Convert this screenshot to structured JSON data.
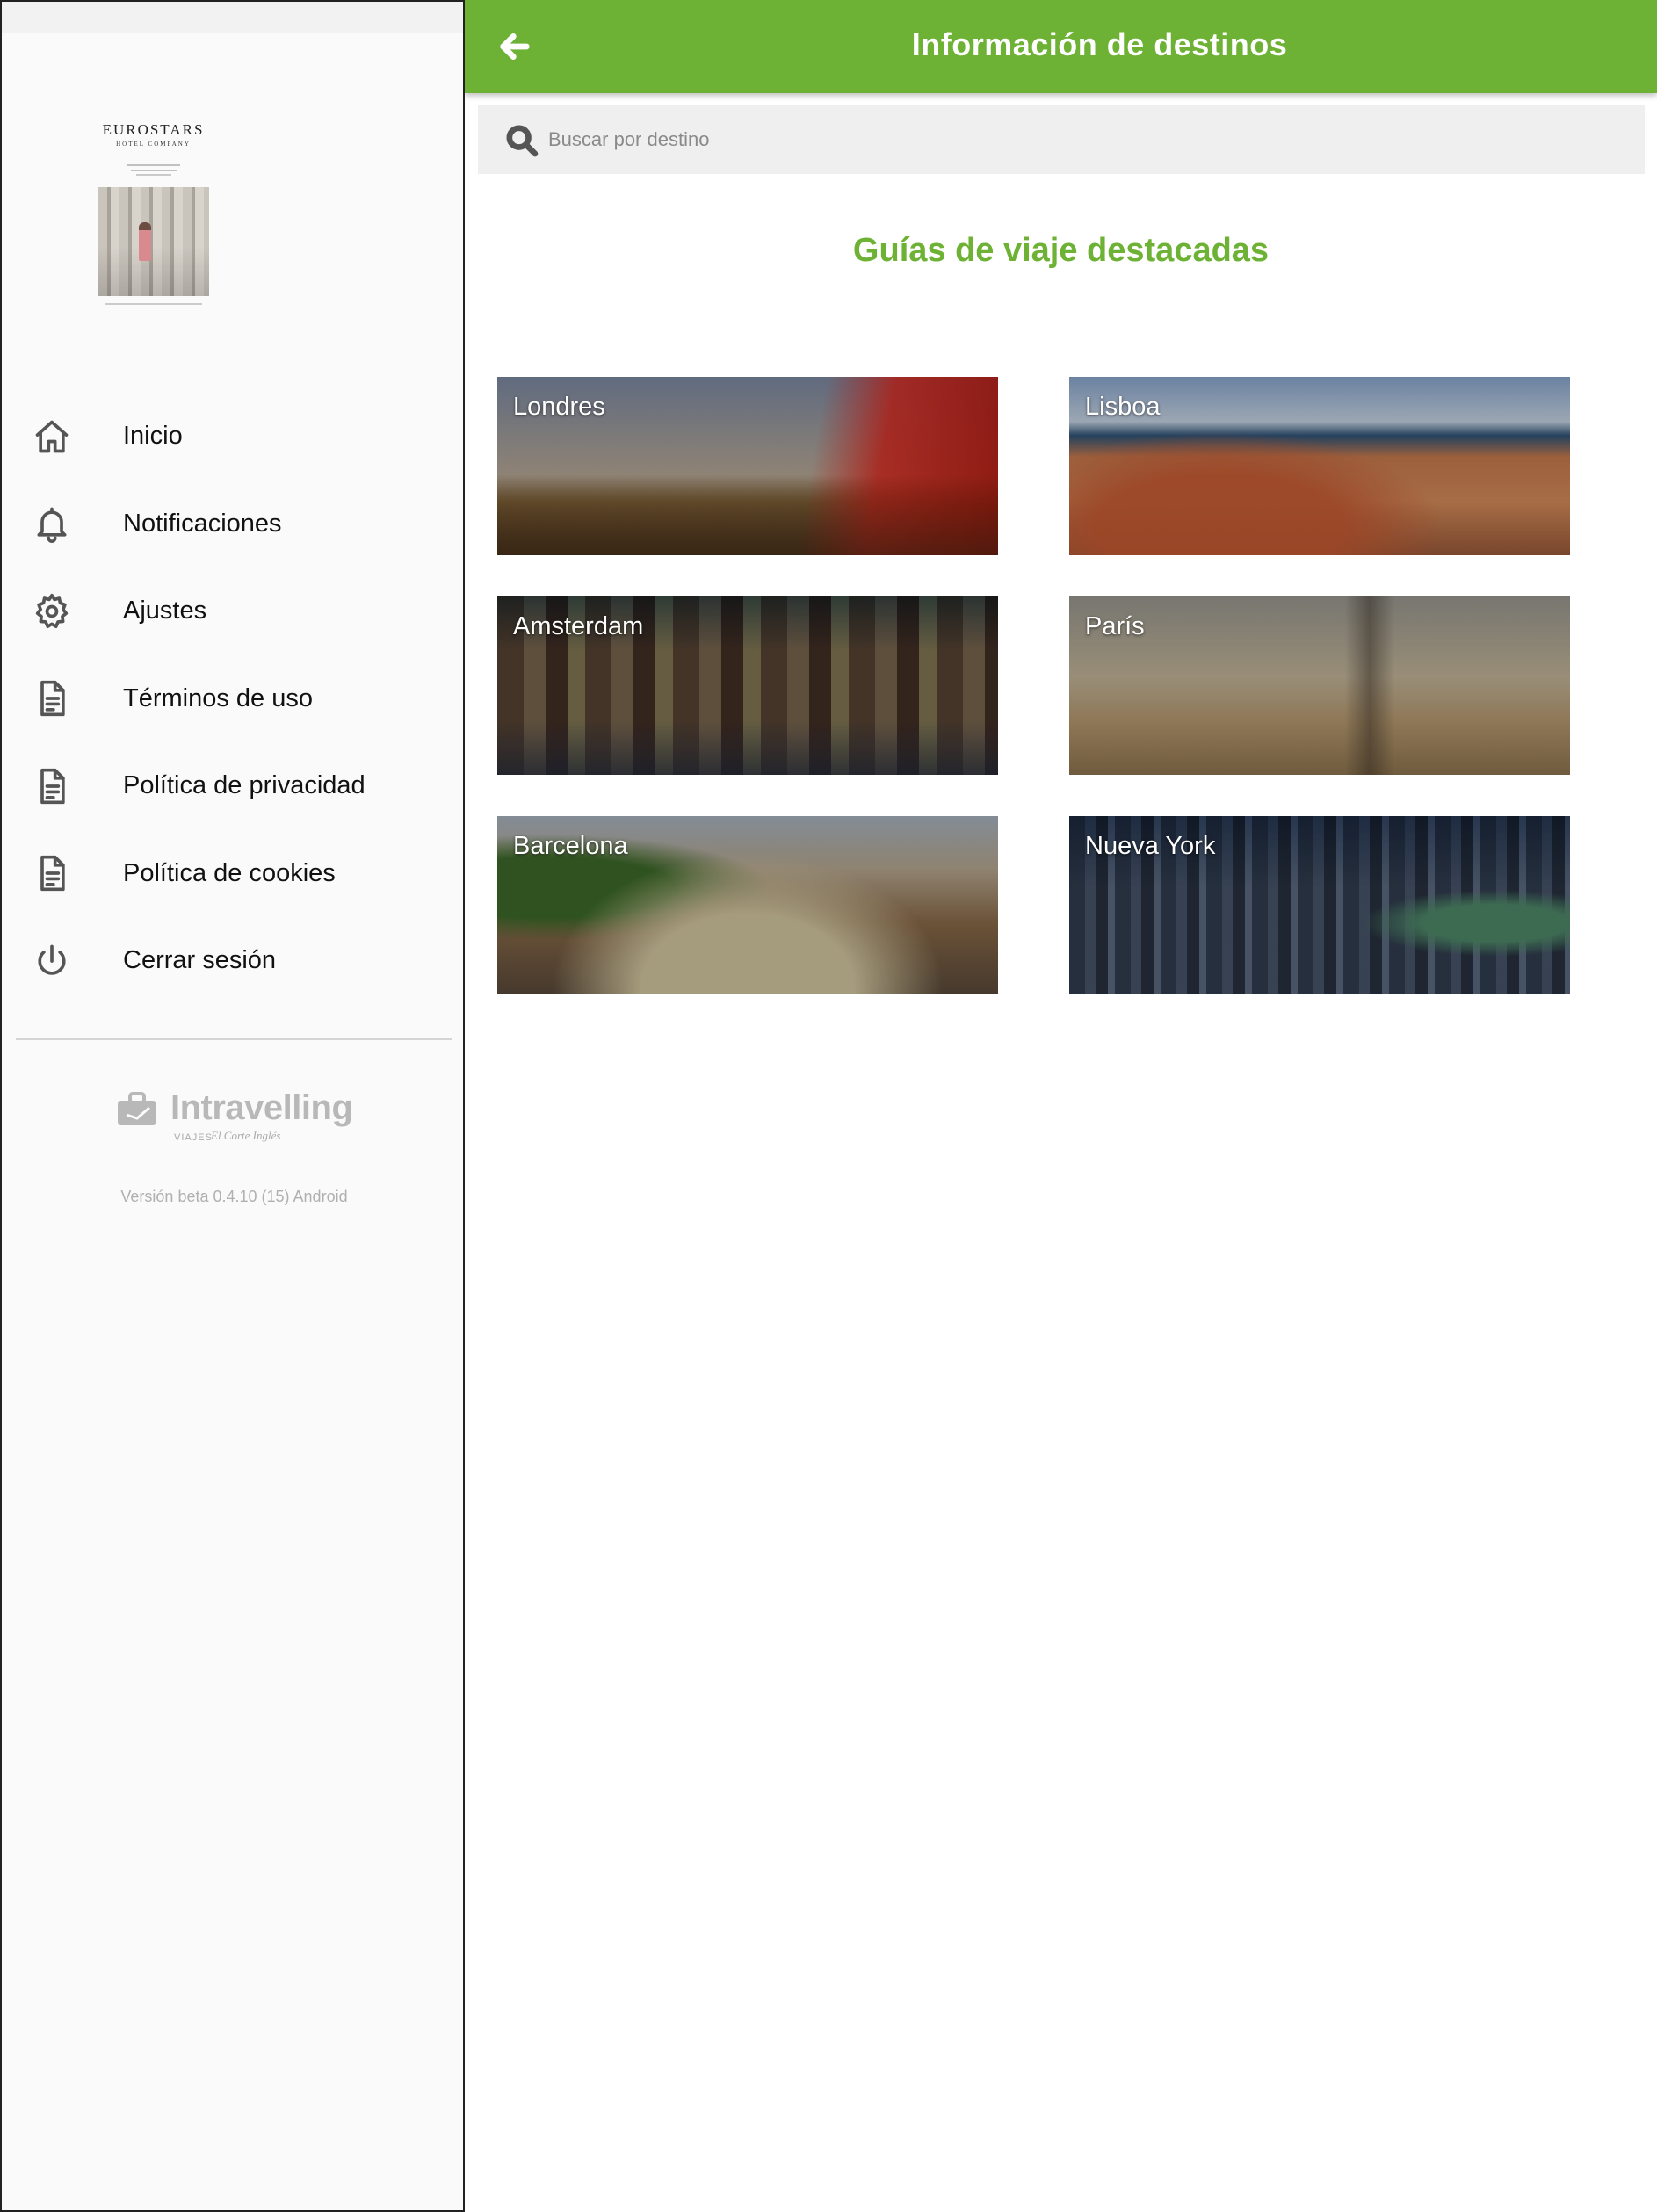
{
  "drawer": {
    "brand": {
      "name": "EUROSTARS",
      "subtitle": "HOTEL COMPANY"
    },
    "menu": [
      {
        "label": "Inicio",
        "icon": "home-icon"
      },
      {
        "label": "Notificaciones",
        "icon": "bell-icon"
      },
      {
        "label": "Ajustes",
        "icon": "gear-icon"
      },
      {
        "label": "Términos de uso",
        "icon": "document-icon"
      },
      {
        "label": "Política de privacidad",
        "icon": "document-icon"
      },
      {
        "label": "Política de cookies",
        "icon": "document-icon"
      },
      {
        "label": "Cerrar sesión",
        "icon": "power-icon"
      }
    ],
    "footer": {
      "logo_text": "Intravelling",
      "logo_sub": "VIAJES",
      "logo_sub_brand": "El Corte Inglés",
      "version": "Versión beta 0.4.10 (15) Android"
    }
  },
  "appbar": {
    "title": "Información de destinos",
    "back_icon": "arrow-left-icon",
    "color": "#6db234"
  },
  "search": {
    "placeholder": "Buscar por destino",
    "value": "",
    "icon": "search-icon"
  },
  "section": {
    "title": "Guías de viaje destacadas",
    "color": "#6db234"
  },
  "destinations": [
    {
      "label": "Londres"
    },
    {
      "label": "Lisboa"
    },
    {
      "label": "Amsterdam"
    },
    {
      "label": "París"
    },
    {
      "label": "Barcelona"
    },
    {
      "label": "Nueva York"
    }
  ]
}
